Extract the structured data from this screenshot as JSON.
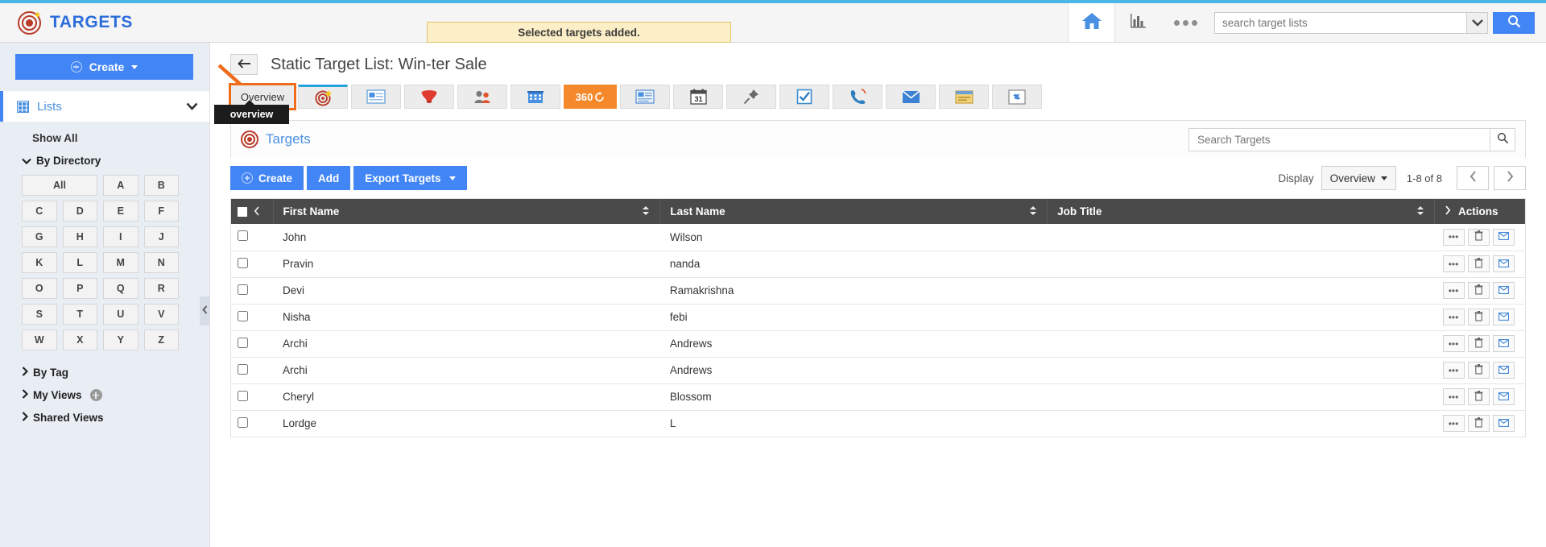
{
  "header": {
    "brand": "TARGETS",
    "brand_icon": "target-icon",
    "alert_message": "Selected targets added.",
    "home_icon": "home-icon",
    "chart_icon": "bar-chart-icon",
    "more_icon": "more-dots-icon",
    "search_placeholder": "search target lists",
    "search_value": "",
    "search_caret_icon": "chevron-down-icon",
    "search_go_icon": "search-icon",
    "accent_blue": "#4285f4",
    "strip_blue": "#4bb6e8",
    "alert_bg": "#fcefc7"
  },
  "sidebar": {
    "create_label": "Create",
    "create_icon": "plus-circle-icon",
    "module_label": "Lists",
    "module_icon": "grid-icon",
    "show_all_label": "Show All",
    "by_directory_label": "By Directory",
    "alphabet": [
      "All",
      "A",
      "B",
      "C",
      "D",
      "E",
      "F",
      "G",
      "H",
      "I",
      "J",
      "K",
      "L",
      "M",
      "N",
      "O",
      "P",
      "Q",
      "R",
      "S",
      "T",
      "U",
      "V",
      "W",
      "X",
      "Y",
      "Z"
    ],
    "groups": [
      {
        "label": "By Tag",
        "expanded": false,
        "has_add": false
      },
      {
        "label": "My Views",
        "expanded": false,
        "has_add": true
      },
      {
        "label": "Shared Views",
        "expanded": false,
        "has_add": false
      }
    ],
    "collapse_icon": "chevron-left-icon"
  },
  "record": {
    "back_icon": "back-arrow-icon",
    "title": "Static Target List: Win-ter Sale"
  },
  "tabs": [
    {
      "label": "Overview",
      "icon": "overview-tab",
      "type": "text",
      "highlighted": true
    },
    {
      "label": "",
      "icon": "targets-tab-icon",
      "type": "icon",
      "top_accent": true
    },
    {
      "label": "",
      "icon": "contact-card-icon",
      "type": "icon"
    },
    {
      "label": "",
      "icon": "filter-funnel-icon",
      "type": "icon"
    },
    {
      "label": "",
      "icon": "leads-icon",
      "type": "icon"
    },
    {
      "label": "",
      "icon": "accounts-building-icon",
      "type": "icon"
    },
    {
      "label": "360",
      "icon": "360-refresh-icon",
      "type": "icon",
      "orange": true
    },
    {
      "label": "",
      "icon": "news-card-icon",
      "type": "icon"
    },
    {
      "label": "31",
      "icon": "calendar-icon",
      "type": "icon"
    },
    {
      "label": "",
      "icon": "pin-icon",
      "type": "icon"
    },
    {
      "label": "",
      "icon": "checklist-icon",
      "type": "icon"
    },
    {
      "label": "",
      "icon": "phone-calls-icon",
      "type": "icon"
    },
    {
      "label": "",
      "icon": "envelope-icon",
      "type": "icon"
    },
    {
      "label": "",
      "icon": "notes-icon",
      "type": "icon"
    },
    {
      "label": "",
      "icon": "link-attachment-icon",
      "type": "icon"
    }
  ],
  "tooltip": {
    "text": "overview"
  },
  "panel": {
    "title": "Targets",
    "title_icon": "target-icon",
    "search_placeholder": "Search Targets",
    "search_value": "",
    "search_icon": "search-icon"
  },
  "toolbar": {
    "create_label": "Create",
    "create_icon": "plus-circle-icon",
    "add_label": "Add",
    "export_label": "Export Targets",
    "export_caret_icon": "caret-down-icon",
    "display_label": "Display",
    "display_value": "Overview",
    "display_caret_icon": "caret-down-icon",
    "pager_count": "1-8 of 8",
    "prev_icon": "chevron-left-icon",
    "next_icon": "chevron-right-icon"
  },
  "table": {
    "select_all_icon": "checkbox-icon",
    "collapse_col_icon": "chevron-left-icon",
    "expand_actions_icon": "chevron-right-icon",
    "columns": [
      {
        "label": "First Name",
        "sortable": true
      },
      {
        "label": "Last Name",
        "sortable": true
      },
      {
        "label": "Job Title",
        "sortable": true
      }
    ],
    "actions_header": "Actions",
    "row_action_icons": [
      "more-dots-icon",
      "trash-icon",
      "envelope-icon"
    ],
    "rows": [
      {
        "first_name": "John",
        "last_name": "Wilson",
        "job_title": ""
      },
      {
        "first_name": "Pravin",
        "last_name": "nanda",
        "job_title": ""
      },
      {
        "first_name": "Devi",
        "last_name": "Ramakrishna",
        "job_title": ""
      },
      {
        "first_name": "Nisha",
        "last_name": "febi",
        "job_title": ""
      },
      {
        "first_name": "Archi",
        "last_name": "Andrews",
        "job_title": ""
      },
      {
        "first_name": "Archi",
        "last_name": "Andrews",
        "job_title": ""
      },
      {
        "first_name": "Cheryl",
        "last_name": "Blossom",
        "job_title": ""
      },
      {
        "first_name": "Lordge",
        "last_name": "L",
        "job_title": ""
      }
    ]
  },
  "annotation": {
    "arrow_color": "#ef6c1a",
    "points_to": "overview-tab"
  }
}
